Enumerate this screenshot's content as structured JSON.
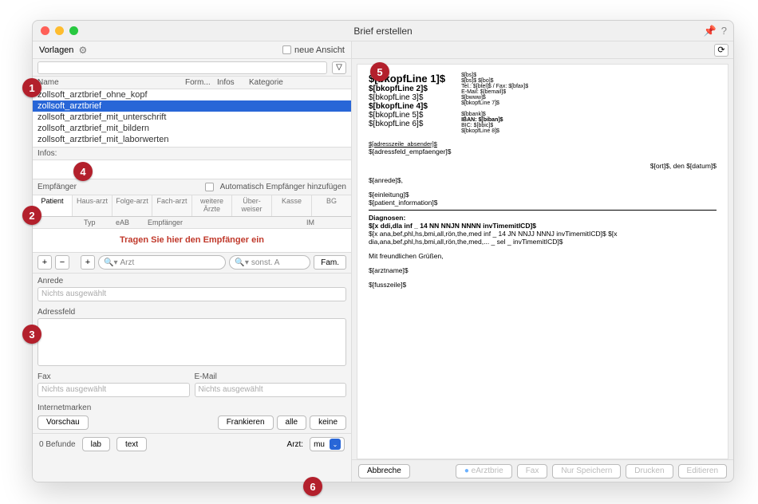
{
  "window": {
    "title": "Brief erstellen"
  },
  "vorlagen": {
    "label": "Vorlagen",
    "neue_ansicht": "neue Ansicht",
    "columns": {
      "name": "Name",
      "form": "Form...",
      "infos": "Infos",
      "kategorie": "Kategorie"
    },
    "items": [
      "zollsoft_arztbrief_ohne_kopf",
      "zollsoft_arztbrief",
      "zollsoft_arztbrief_mit_unterschrift",
      "zollsoft_arztbrief_mit_bildern",
      "zollsoft_arztbrief_mit_laborwerten"
    ],
    "selected_index": 1,
    "infos_label": "Infos:"
  },
  "empfaenger": {
    "label": "Empfänger",
    "auto_label": "Automatisch Empfänger hinzufügen",
    "tabs": [
      "Patient",
      "Haus-arzt",
      "Folge-arzt",
      "Fach-arzt",
      "weitere Ärzte",
      "Über-weiser",
      "Kasse",
      "BG"
    ],
    "subcols": {
      "typ": "Typ",
      "eab": "eAB",
      "empf": "Empfänger",
      "im": "IM"
    },
    "placeholder": "Tragen Sie hier den Empfänger ein",
    "search_arzt": "Arzt",
    "search_sonst": "sonst. A",
    "fam": "Fam."
  },
  "anrede": {
    "label": "Anrede",
    "placeholder": "Nichts ausgewählt"
  },
  "adressfeld": {
    "label": "Adressfeld"
  },
  "fax": {
    "label": "Fax",
    "placeholder": "Nichts ausgewählt"
  },
  "email": {
    "label": "E-Mail",
    "placeholder": "Nichts ausgewählt"
  },
  "internetmarken": {
    "label": "Internetmarken",
    "vorschau": "Vorschau",
    "frankieren": "Frankieren",
    "alle": "alle",
    "keine": "keine"
  },
  "bottom_left": {
    "befunde": "0 Befunde",
    "lab": "lab",
    "text": "text",
    "arzt_label": "Arzt:",
    "arzt_value": "mu"
  },
  "preview": {
    "bkopf": [
      "$[bkopfLine 1]$",
      "$[bkopfLine 2]$",
      "$[bkopfLine 3]$",
      "$[bkopfLine 4]$",
      "$[bkopfLine 5]$",
      "$[bkopfLine 6]$"
    ],
    "headr": [
      "$[bs]$",
      "$[bs]$ $[bo]$",
      "Tel.: $[btel]$ / Fax: $[bfax]$",
      "E-Mail: $[bemail]$",
      "$[bwww]$",
      "$[bkopfLine 7]$",
      "",
      "$[bbank]$",
      "IBAN: $[biban]$",
      "BIC: $[bbic]$",
      "$[bkopfLine 8]$"
    ],
    "adresszeile_absender": "$[adresszeile_absender]$",
    "adressfeld_empfaenger": "$[adressfeld_empfaenger]$",
    "ort_datum": "$[ort]$, den $[datum]$",
    "anrede": "$[anrede]$,",
    "einleitung": "$[einleitung]$",
    "patient_info": "$[patient_information]$",
    "diagnosen_label": "Diagnosen:",
    "diag_line1": "$[x ddi,dla inf _ 14 NN NNJN NNNN invTimemitICD]$",
    "diag_line2": "$[x ana,bef,phl,hs,bmi,all,rön,the,med inf _ 14 JN NNJJ NNNJ invTimemitICD]$ $[x dia,ana,bef,phl,hs,bmi,all,rön,the,med,... _ sel _ invTimemitICD]$",
    "gruss": "Mit freundlichen Grüßen,",
    "arztname": "$[arztname]$",
    "fusszeile": "$[fusszeile]$"
  },
  "bottom_right": {
    "abbrechen": "Abbreche",
    "earzt": "eArztbrie",
    "fax": "Fax",
    "nur_speichern": "Nur Speichern",
    "drucken": "Drucken",
    "editieren": "Editieren"
  },
  "badges": [
    "1",
    "2",
    "3",
    "4",
    "5",
    "6"
  ]
}
